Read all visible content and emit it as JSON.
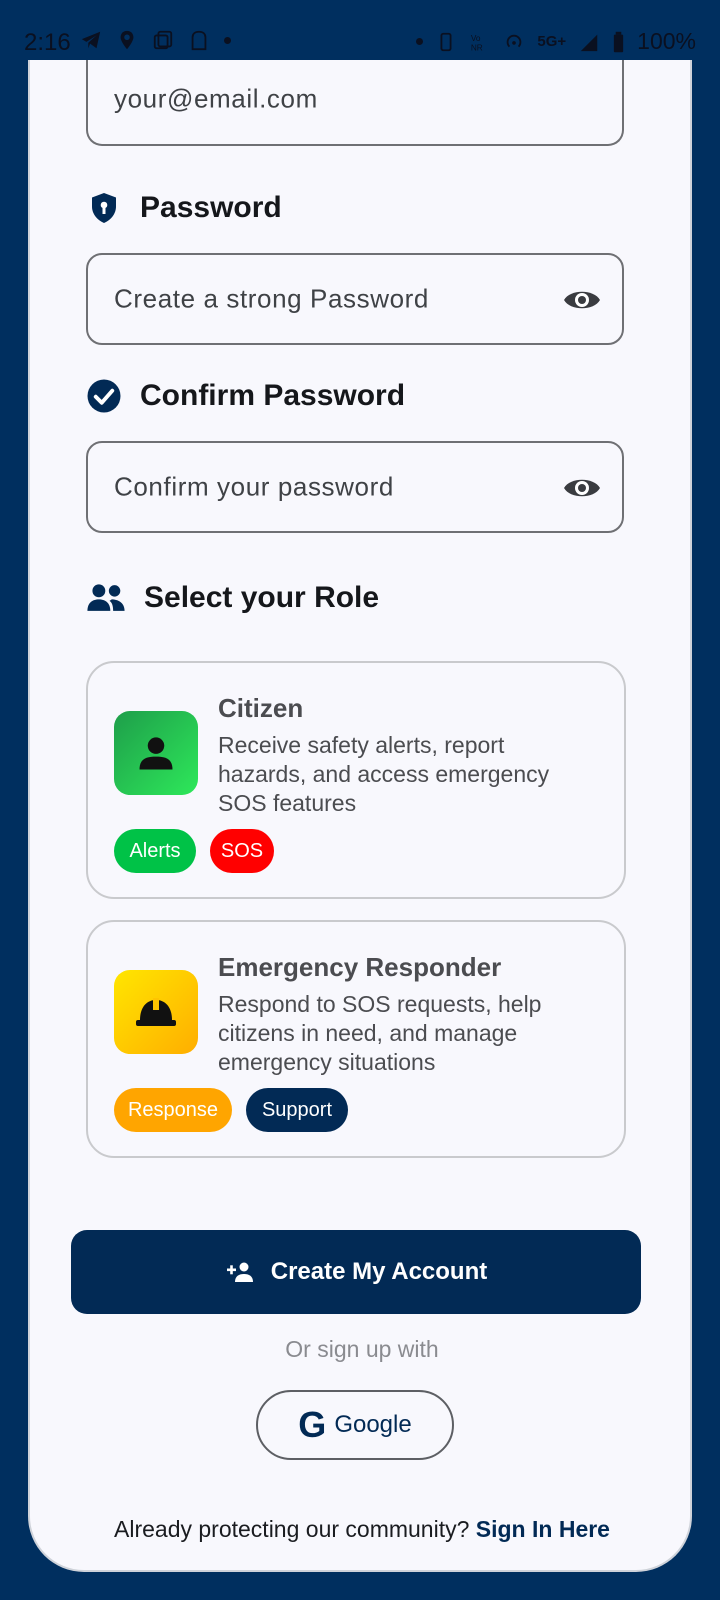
{
  "status_bar": {
    "time": "2:16",
    "battery": "100%",
    "network": "5G+"
  },
  "form": {
    "email": {
      "value": "your@email.com"
    },
    "password": {
      "label": "Password",
      "placeholder": "Create a strong Password"
    },
    "confirm_password": {
      "label": "Confirm Password",
      "placeholder": "Confirm your password"
    },
    "role_section": {
      "label": "Select your Role"
    },
    "roles": [
      {
        "title": "Citizen",
        "description": "Receive safety alerts, report hazards, and access emergency SOS features",
        "tags": [
          {
            "label": "Alerts",
            "color": "#00c247"
          },
          {
            "label": "SOS",
            "color": "#ff0000"
          }
        ]
      },
      {
        "title": "Emergency Responder",
        "description": "Respond to SOS requests, help citizens in need, and manage emergency situations",
        "tags": [
          {
            "label": "Response",
            "color": "#ffa500"
          },
          {
            "label": "Support",
            "color": "#022a55"
          }
        ]
      }
    ],
    "create_button": "Create My Account",
    "or_text": "Or sign up with",
    "google_button": "Google",
    "footer_text": "Already protecting our community?",
    "footer_link": "Sign In Here"
  },
  "colors": {
    "primary": "#022a55",
    "background": "#002f5f",
    "card": "#f8f8fd"
  }
}
